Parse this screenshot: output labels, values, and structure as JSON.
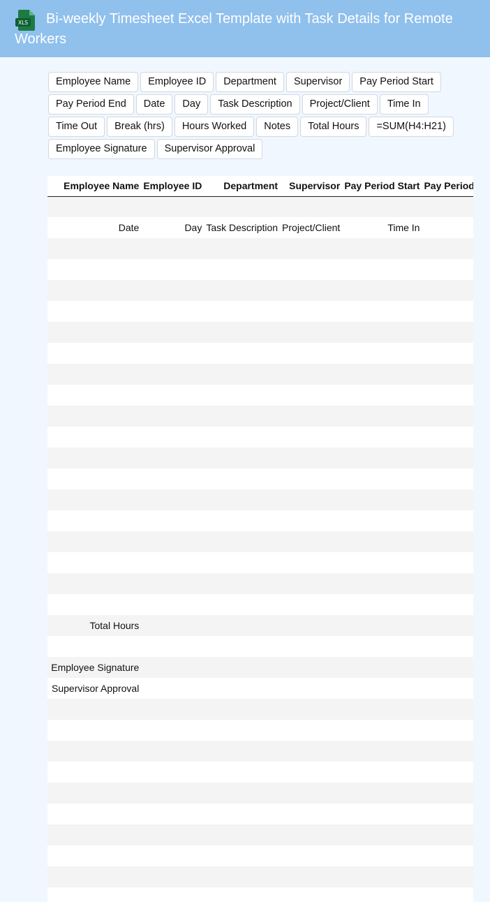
{
  "header": {
    "title": "Bi-weekly Timesheet Excel Template with Task Details for Remote Workers",
    "icon": "xls-file-icon",
    "icon_label": "XLS",
    "accent": "#90c0ec"
  },
  "chips": [
    "Employee Name",
    "Employee ID",
    "Department",
    "Supervisor",
    "Pay Period Start",
    "Pay Period End",
    "Date",
    "Day",
    "Task Description",
    "Project/Client",
    "Time In",
    "Time Out",
    "Break (hrs)",
    "Hours Worked",
    "Notes",
    "Total Hours",
    "=SUM(H4:H21)",
    "Employee Signature",
    "Supervisor Approval"
  ],
  "sheet": {
    "columns": [
      "",
      "Employee Name",
      "Employee ID",
      "Department",
      "Supervisor",
      "Pay Period Start",
      "Pay Period End"
    ],
    "rows": [
      {
        "n": "0",
        "cells": [
          "",
          "",
          "",
          "",
          "",
          ""
        ]
      },
      {
        "n": "1",
        "cells": [
          "Date",
          "Day",
          "Task Description",
          "Project/Client",
          "Time In",
          ""
        ]
      },
      {
        "n": "2",
        "cells": [
          "",
          "",
          "",
          "",
          "",
          ""
        ]
      },
      {
        "n": "3",
        "cells": [
          "",
          "",
          "",
          "",
          "",
          ""
        ]
      },
      {
        "n": "4",
        "cells": [
          "",
          "",
          "",
          "",
          "",
          ""
        ]
      },
      {
        "n": "5",
        "cells": [
          "",
          "",
          "",
          "",
          "",
          ""
        ]
      },
      {
        "n": "6",
        "cells": [
          "",
          "",
          "",
          "",
          "",
          ""
        ]
      },
      {
        "n": "7",
        "cells": [
          "",
          "",
          "",
          "",
          "",
          ""
        ]
      },
      {
        "n": "8",
        "cells": [
          "",
          "",
          "",
          "",
          "",
          ""
        ]
      },
      {
        "n": "9",
        "cells": [
          "",
          "",
          "",
          "",
          "",
          ""
        ]
      },
      {
        "n": "0",
        "cells": [
          "",
          "",
          "",
          "",
          "",
          ""
        ]
      },
      {
        "n": "1",
        "cells": [
          "",
          "",
          "",
          "",
          "",
          ""
        ]
      },
      {
        "n": "2",
        "cells": [
          "",
          "",
          "",
          "",
          "",
          ""
        ]
      },
      {
        "n": "3",
        "cells": [
          "",
          "",
          "",
          "",
          "",
          ""
        ]
      },
      {
        "n": "4",
        "cells": [
          "",
          "",
          "",
          "",
          "",
          ""
        ]
      },
      {
        "n": "5",
        "cells": [
          "",
          "",
          "",
          "",
          "",
          ""
        ]
      },
      {
        "n": "6",
        "cells": [
          "",
          "",
          "",
          "",
          "",
          ""
        ]
      },
      {
        "n": "7",
        "cells": [
          "",
          "",
          "",
          "",
          "",
          ""
        ]
      },
      {
        "n": "8",
        "cells": [
          "",
          "",
          "",
          "",
          "",
          ""
        ]
      },
      {
        "n": "9",
        "cells": [
          "",
          "",
          "",
          "",
          "",
          ""
        ]
      },
      {
        "n": "0",
        "cells": [
          "Total Hours",
          "",
          "",
          "",
          "",
          ""
        ]
      },
      {
        "n": "1",
        "cells": [
          "",
          "",
          "",
          "",
          "",
          ""
        ]
      },
      {
        "n": "2",
        "cells": [
          "Employee Signature",
          "",
          "",
          "",
          "",
          ""
        ]
      },
      {
        "n": "3",
        "cells": [
          "Supervisor Approval",
          "",
          "",
          "",
          "",
          ""
        ]
      },
      {
        "n": "4",
        "cells": [
          "",
          "",
          "",
          "",
          "",
          ""
        ]
      },
      {
        "n": "5",
        "cells": [
          "",
          "",
          "",
          "",
          "",
          ""
        ]
      },
      {
        "n": "6",
        "cells": [
          "",
          "",
          "",
          "",
          "",
          ""
        ]
      },
      {
        "n": "7",
        "cells": [
          "",
          "",
          "",
          "",
          "",
          ""
        ]
      },
      {
        "n": "8",
        "cells": [
          "",
          "",
          "",
          "",
          "",
          ""
        ]
      },
      {
        "n": "9",
        "cells": [
          "",
          "",
          "",
          "",
          "",
          ""
        ]
      },
      {
        "n": "0",
        "cells": [
          "",
          "",
          "",
          "",
          "",
          ""
        ]
      },
      {
        "n": "1",
        "cells": [
          "",
          "",
          "",
          "",
          "",
          ""
        ]
      },
      {
        "n": "2",
        "cells": [
          "",
          "",
          "",
          "",
          "",
          ""
        ]
      },
      {
        "n": "3",
        "cells": [
          "",
          "",
          "",
          "",
          "",
          ""
        ]
      }
    ]
  }
}
